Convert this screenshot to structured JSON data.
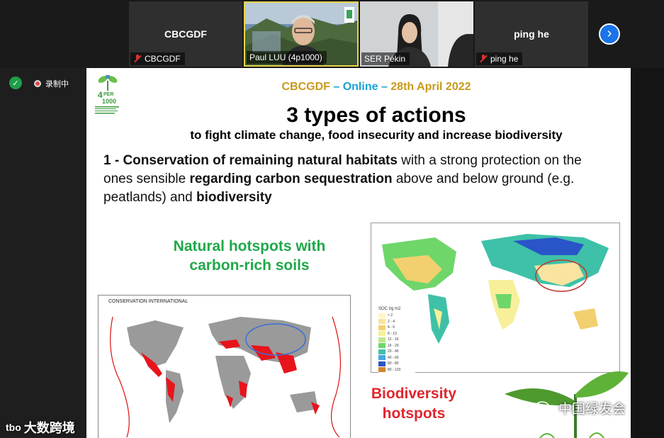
{
  "participants": [
    {
      "name": "CBCGDF",
      "center_label": "CBCGDF",
      "muted": true,
      "video": false
    },
    {
      "name": "Paul LUU (4p1000)",
      "center_label": "",
      "muted": false,
      "video": true,
      "active": true
    },
    {
      "name": "SER Pékin",
      "center_label": "",
      "muted": false,
      "video": true
    },
    {
      "name": "ping he",
      "center_label": "ping he",
      "muted": true,
      "video": false
    }
  ],
  "controls": {
    "next_icon": "chevron-right-icon",
    "next_glyph": "›"
  },
  "status": {
    "recording_label": "录制中",
    "security_icon": "shield-check-icon"
  },
  "slide": {
    "logo": {
      "line1": "4",
      "line2": "PER",
      "line3": "1000"
    },
    "header": {
      "part1": "CBCGDF",
      "part2": " – Online – ",
      "part3": "28th April 2022"
    },
    "title": "3 types of actions",
    "subtitle": "to fight climate change, food insecurity and increase biodiversity",
    "paragraph": {
      "s1": "1 - Conservation of remaining natural habitats",
      "s2": " with a strong protection on the ones sensible ",
      "s3": "regarding carbon sequestration",
      "s4": " above and below ground (e.g. peatlands) and ",
      "s5": "biodiversity"
    },
    "green_heading_line1": "Natural hotspots with",
    "green_heading_line2": "carbon-rich soils",
    "left_map_label": "CONSERVATION INTERNATIONAL",
    "bio_line1": "Biodiversity",
    "bio_line2": "hotspots",
    "legend": {
      "title": "SOC t/g m2",
      "items": [
        {
          "label": "< 2",
          "color": "#fff6c8"
        },
        {
          "label": "2 - 4",
          "color": "#f8e4a0"
        },
        {
          "label": "4 - 6",
          "color": "#f2d070"
        },
        {
          "label": "8 - 13",
          "color": "#f7ef9a"
        },
        {
          "label": "12 - 16",
          "color": "#bde78a"
        },
        {
          "label": "16 - 20",
          "color": "#6fd66a"
        },
        {
          "label": "20 - 40",
          "color": "#3ec1a8"
        },
        {
          "label": "40 - 60",
          "color": "#4aa6e0"
        },
        {
          "label": "60 - 80",
          "color": "#2a55c8"
        },
        {
          "label": "80 - 120",
          "color": "#d2862e"
        }
      ]
    }
  },
  "watermarks": {
    "wechat": "中国绿发会",
    "brand": "大数跨境",
    "brand_logo": "tbo"
  }
}
